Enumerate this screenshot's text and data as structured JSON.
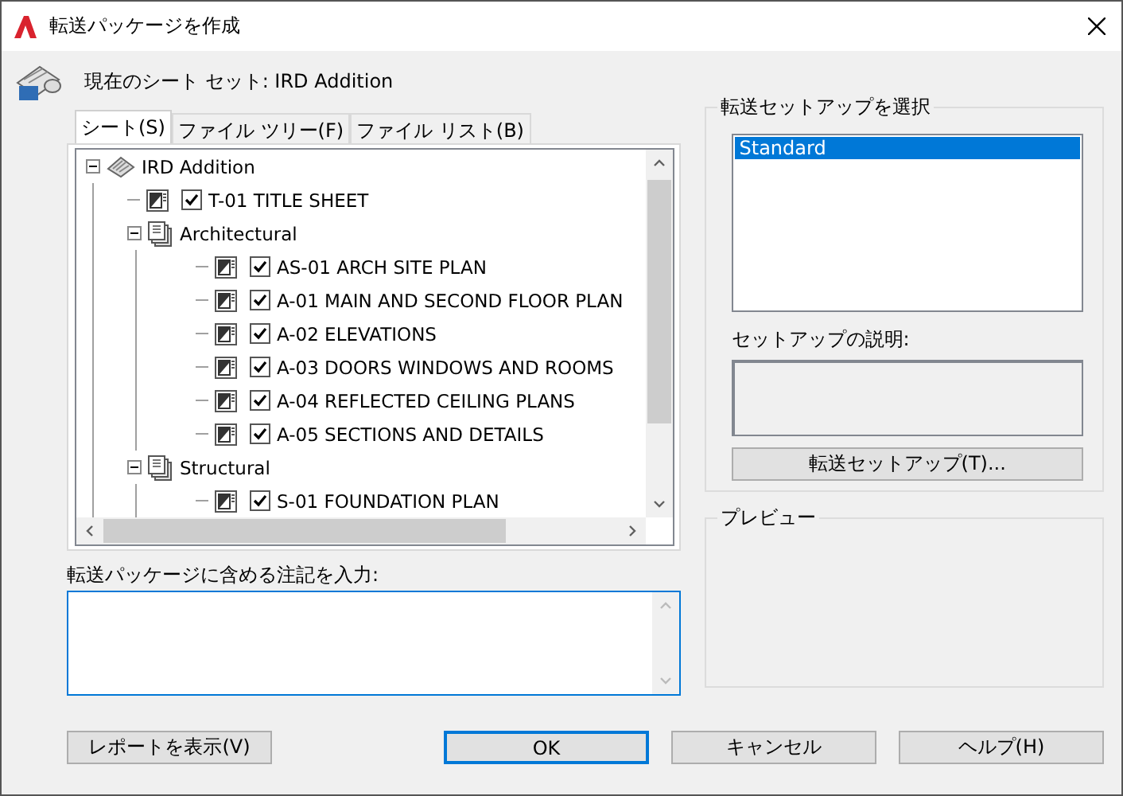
{
  "window": {
    "title": "転送パッケージを作成"
  },
  "current_sheet_set": "現在のシート セット: IRD Addition",
  "tabs": [
    {
      "label": "シート(S)",
      "selected": true
    },
    {
      "label": "ファイル ツリー(F)",
      "selected": false
    },
    {
      "label": "ファイル リスト(B)",
      "selected": false
    }
  ],
  "tree": [
    {
      "kind": "sheetset",
      "label": "IRD Addition",
      "expanded": true,
      "children": [
        {
          "kind": "sheet",
          "label": "T-01 TITLE SHEET",
          "checked": true
        },
        {
          "kind": "subset",
          "label": "Architectural",
          "expanded": true,
          "children": [
            {
              "kind": "sheet",
              "label": "AS-01 ARCH SITE PLAN",
              "checked": true
            },
            {
              "kind": "sheet",
              "label": "A-01 MAIN AND SECOND FLOOR PLAN",
              "checked": true
            },
            {
              "kind": "sheet",
              "label": "A-02 ELEVATIONS",
              "checked": true
            },
            {
              "kind": "sheet",
              "label": "A-03 DOORS WINDOWS AND ROOMS",
              "checked": true
            },
            {
              "kind": "sheet",
              "label": "A-04 REFLECTED CEILING PLANS",
              "checked": true
            },
            {
              "kind": "sheet",
              "label": "A-05 SECTIONS AND DETAILS",
              "checked": true
            }
          ]
        },
        {
          "kind": "subset",
          "label": "Structural",
          "expanded": true,
          "children": [
            {
              "kind": "sheet",
              "label": "S-01 FOUNDATION PLAN",
              "checked": true
            }
          ]
        }
      ]
    }
  ],
  "notes": {
    "label": "転送パッケージに含める注記を入力:"
  },
  "transmittal_setups": {
    "title": "転送セットアップを選択",
    "items": [
      {
        "label": "Standard",
        "selected": true
      }
    ],
    "description_label": "セットアップの説明:",
    "setup_button": "転送セットアップ(T)..."
  },
  "preview": {
    "title": "プレビュー"
  },
  "buttons": [
    {
      "label": "レポートを表示(V)",
      "default": false
    },
    {
      "label": "OK",
      "default": true
    },
    {
      "label": "キャンセル",
      "default": false
    },
    {
      "label": "ヘルプ(H)",
      "default": false
    }
  ]
}
